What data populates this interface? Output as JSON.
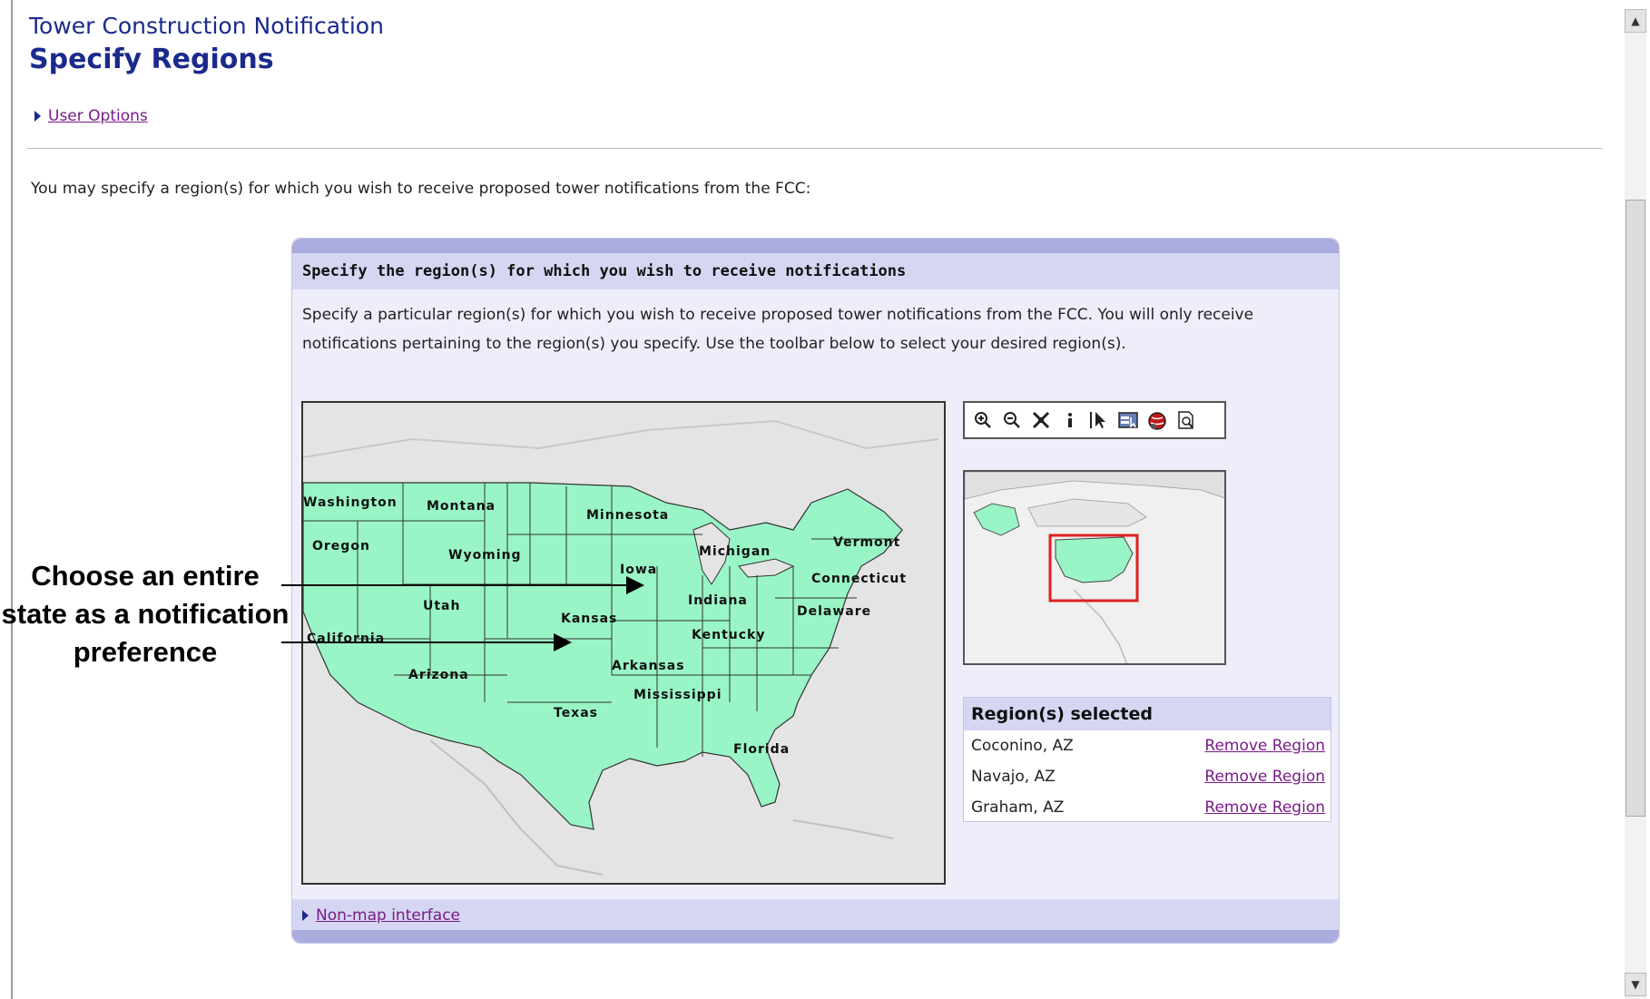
{
  "header": {
    "app_title": "Tower Construction Notification",
    "page_title": "Specify Regions",
    "user_options_link": "User Options"
  },
  "intro_text": "You may specify a region(s) for which you wish to receive proposed tower notifications from the FCC:",
  "panel": {
    "title": "Specify the region(s) for which you wish to receive notifications",
    "description": "Specify a particular region(s) for which you wish to receive proposed tower notifications from the FCC. You will only receive notifications pertaining to the region(s) you specify. Use the toolbar below to select your desired region(s).",
    "map_states": [
      "Washington",
      "Montana",
      "Minnesota",
      "Oregon",
      "Wyoming",
      "Michigan",
      "Vermont",
      "Iowa",
      "Connecticut",
      "Indiana",
      "Utah",
      "Kansas",
      "Delaware",
      "California",
      "Kentucky",
      "Arkansas",
      "Arizona",
      "Mississippi",
      "Texas",
      "Florida"
    ],
    "toolbar_icons": [
      "zoom-in-icon",
      "zoom-out-icon",
      "full-extent-icon",
      "info-icon",
      "select-arrow-icon",
      "identify-box-icon",
      "globe-icon",
      "print-preview-icon"
    ],
    "regions_selected": {
      "title": "Region(s) selected",
      "remove_label": "Remove Region",
      "items": [
        "Coconino, AZ",
        "Navajo, AZ",
        "Graham, AZ"
      ]
    },
    "footer_link": "Non-map interface"
  },
  "callout": {
    "text_line1": "Choose an entire",
    "text_line2": "state as a notification",
    "text_line3": "preference"
  },
  "colors": {
    "title_blue": "#1a2a8c",
    "link_purple": "#7a1a8a",
    "map_land": "#99f5c6",
    "panel_bg": "#eeeefb",
    "panel_header": "#d5d7f2",
    "overview_box": "#e02020"
  }
}
